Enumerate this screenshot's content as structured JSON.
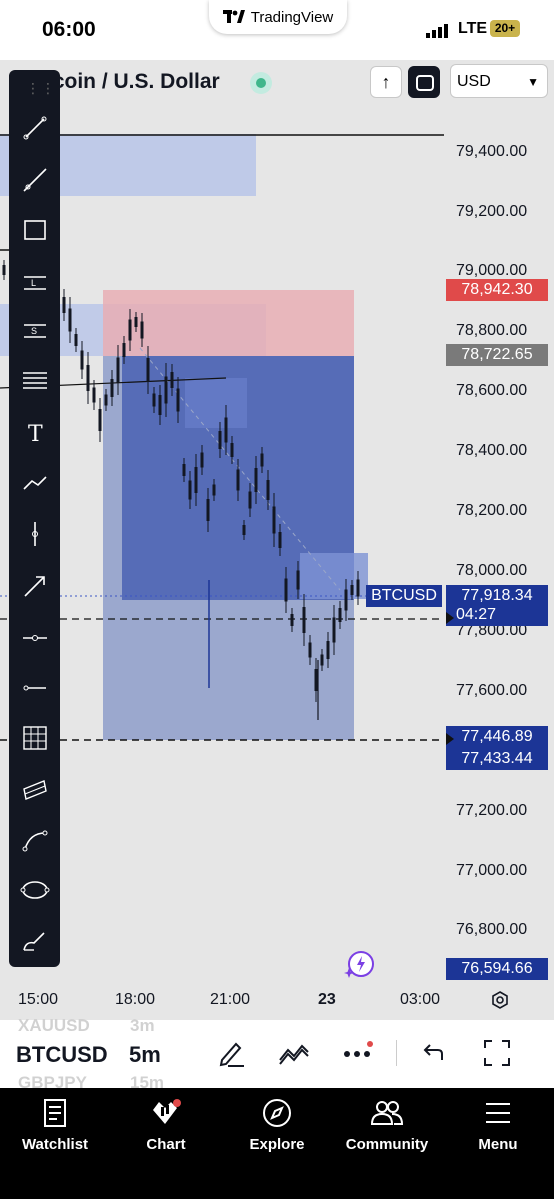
{
  "status_bar": {
    "time": "06:00",
    "network": "LTE",
    "battery": "20+",
    "app_pill": "TradingView"
  },
  "header": {
    "pair_title": "itcoin / U.S. Dollar",
    "currency": "USD"
  },
  "price_axis": {
    "labels": [
      "79,400.00",
      "79,200.00",
      "79,000.00",
      "78,800.00",
      "78,600.00",
      "78,400.00",
      "78,200.00",
      "78,000.00",
      "77,800.00",
      "77,600.00",
      "77,200.00",
      "77,000.00",
      "76,800.00"
    ],
    "tags": [
      {
        "text": "78,942.30",
        "color": "#e04a4a"
      },
      {
        "text": "78,722.65",
        "color": "#7a7a7a"
      },
      {
        "text": "77,918.34",
        "color": "#1c3596"
      },
      {
        "text": "04:27",
        "color": "#1c3596"
      },
      {
        "text": "77,446.89",
        "color": "#1c3596"
      },
      {
        "text": "77,433.44",
        "color": "#1c3596"
      },
      {
        "text": "76,594.66",
        "color": "#1c3596"
      }
    ]
  },
  "symbol_tag": "BTCUSD",
  "time_axis": [
    "15:00",
    "18:00",
    "21:00",
    "23",
    "03:00"
  ],
  "toolbar_tools": [
    "trend-line",
    "ray-line",
    "rectangle",
    "long-position",
    "short-position",
    "horizontal-lines",
    "text",
    "path",
    "vertical-line",
    "arrow",
    "horizontal-ray",
    "horizontal-segment",
    "grid",
    "parallel-channel",
    "curve",
    "ellipse",
    "brush"
  ],
  "bottom_bar": {
    "symbol": "BTCUSD",
    "timeframe": "5m",
    "ghost_top": [
      "XAUUSD",
      "3m"
    ],
    "ghost_bottom": [
      "GBPJPY",
      "15m"
    ]
  },
  "nav": [
    {
      "label": "Watchlist"
    },
    {
      "label": "Chart"
    },
    {
      "label": "Explore"
    },
    {
      "label": "Community"
    },
    {
      "label": "Menu"
    }
  ],
  "colors": {
    "accent": "#1c3596",
    "short_zone": "#e7a8ae",
    "long_zone": "#5a6fb8",
    "bg": "#e6e6e6"
  }
}
